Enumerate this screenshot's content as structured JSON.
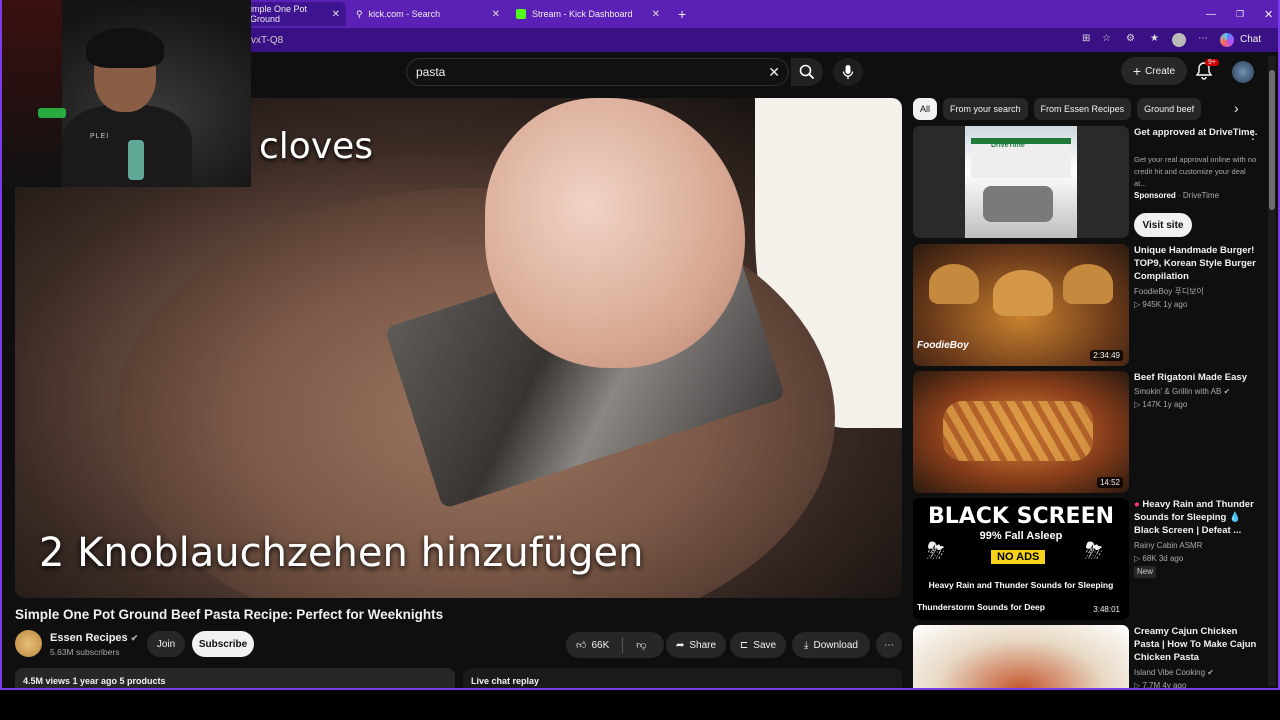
{
  "browser": {
    "tabs": [
      {
        "label": "imple One Pot Ground",
        "active": true
      },
      {
        "label": "kick.com - Search",
        "active": false
      },
      {
        "label": "Stream - Kick Dashboard",
        "active": false
      }
    ],
    "url_fragment": "vxT-Q8",
    "chat_label": "Chat"
  },
  "youtube": {
    "search": {
      "value": "pasta"
    },
    "create_label": "Create",
    "notif_badge": "9+"
  },
  "video": {
    "caption_top": "cloves",
    "caption_bottom": "2 Knoblauchzehen hinzufügen",
    "title": "Simple One Pot Ground Beef Pasta Recipe: Perfect for Weeknights",
    "channel": "Essen Recipes",
    "subscribers": "5.63M subscribers",
    "join_label": "Join",
    "subscribe_label": "Subscribe",
    "likes": "66K",
    "share_label": "Share",
    "save_label": "Save",
    "download_label": "Download",
    "description_meta": "4.5M views  1 year ago  5 products",
    "chat_replay_label": "Live chat replay"
  },
  "webcam": {
    "shirt_text": "PLEI"
  },
  "chips": [
    "All",
    "From your search",
    "From Essen Recipes",
    "Ground beef"
  ],
  "sponsored": {
    "title": "Get approved at DriveTime.",
    "body": "Get your real approval online with no credit hit and customize your deal at...",
    "sponsored_label": "Sponsored",
    "advertiser": "DriveTime",
    "button": "Visit site",
    "sign": "DriveTime"
  },
  "recommendations": [
    {
      "title": "Unique Handmade Burger! TOP9, Korean Style Burger Compilation",
      "channel": "FoodieBoy 푸디보이",
      "meta": "945K  1y ago",
      "duration": "2:34:49",
      "logo": "FoodieBoy"
    },
    {
      "title": "Beef Rigatoni Made Easy",
      "channel": "Smokin' & Grillin with AB",
      "meta": "147K  1y ago",
      "duration": "14:52"
    },
    {
      "title": "Heavy Rain and Thunder Sounds for Sleeping 💧 Black Screen | Defeat ...",
      "channel": "Rainy Cabin ASMR",
      "meta": "68K  3d ago",
      "badge": "New",
      "duration": "3:48:01",
      "thumb_text": {
        "headline": "BLACK SCREEN",
        "sub": "99% Fall Asleep",
        "noads": "NO ADS",
        "line1": "Heavy Rain and Thunder Sounds for Sleeping",
        "line2": "Thunderstorm Sounds for Deep"
      }
    },
    {
      "title": "Creamy Cajun Chicken Pasta | How To Make Cajun Chicken Pasta",
      "channel": "Island Vibe Cooking",
      "meta": "7.7M  4y ago"
    }
  ]
}
